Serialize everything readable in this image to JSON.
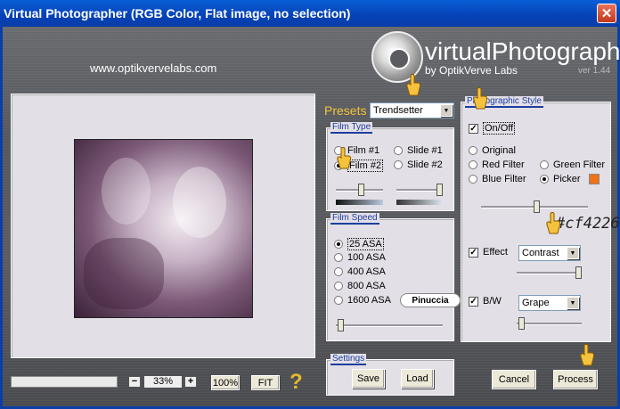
{
  "window": {
    "title": "Virtual Photographer (RGB Color, Flat image, no selection)"
  },
  "header": {
    "website": "www.optikvervelabs.com",
    "logo_text": "virtualPhotographer",
    "logo_sub": "by OptikVerve Labs",
    "version": "ver 1.44"
  },
  "preview": {
    "zoom_minus": "−",
    "zoom_value": "33%",
    "zoom_plus": "+",
    "btn_100": "100%",
    "btn_fit": "FIT",
    "help": "?"
  },
  "presets": {
    "label": "Presets",
    "selected": "Trendsetter"
  },
  "film_type": {
    "title": "Film Type",
    "options": [
      "Film #1",
      "Film #2",
      "Slide #1",
      "Slide #2"
    ],
    "selected": "Film #2"
  },
  "film_speed": {
    "title": "Film Speed",
    "options": [
      "25 ASA",
      "100 ASA",
      "400 ASA",
      "800 ASA",
      "1600 ASA"
    ],
    "selected": "25 ASA"
  },
  "badge": "Pinuccia",
  "settings": {
    "title": "Settings",
    "save": "Save",
    "load": "Load"
  },
  "photographic_style": {
    "title": "Photographic Style",
    "onoff_label": "On/Off",
    "onoff_checked": true,
    "options": [
      "Original",
      "Red Filter",
      "Green Filter",
      "Blue Filter",
      "Picker"
    ],
    "selected": "Picker",
    "picker_color": "#f07218",
    "hex_annotation": "#cf4226",
    "effect_label": "Effect",
    "effect_checked": true,
    "effect_value": "Contrast",
    "bw_label": "B/W",
    "bw_checked": true,
    "bw_value": "Grape"
  },
  "actions": {
    "cancel": "Cancel",
    "process": "Process"
  }
}
